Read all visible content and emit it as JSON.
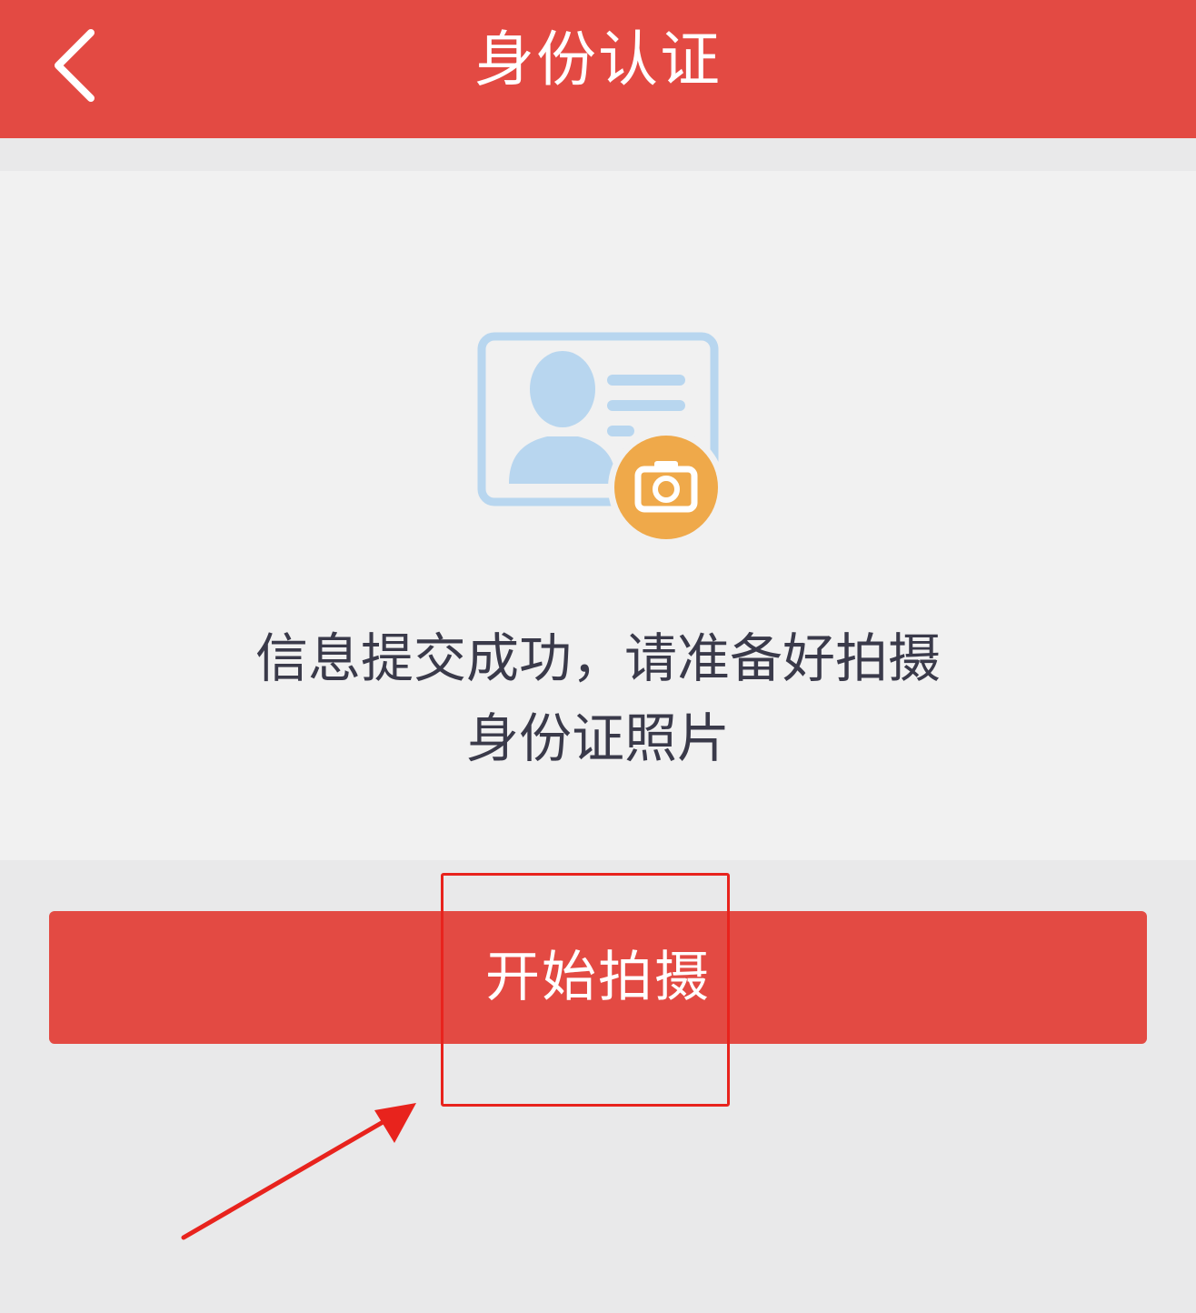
{
  "header": {
    "title": "身份认证",
    "back_icon": "chevron-left-icon"
  },
  "main": {
    "illustration_icon": "id-card-camera-icon",
    "message_line1": "信息提交成功，请准备好拍摄",
    "message_line2": "身份证照片"
  },
  "actions": {
    "start_label": "开始拍摄"
  },
  "annotations": {
    "highlight_color": "#e8231d"
  },
  "colors": {
    "brand_red": "#e34a43",
    "card_blue": "#b8d6ef",
    "camera_orange": "#efa94a"
  }
}
